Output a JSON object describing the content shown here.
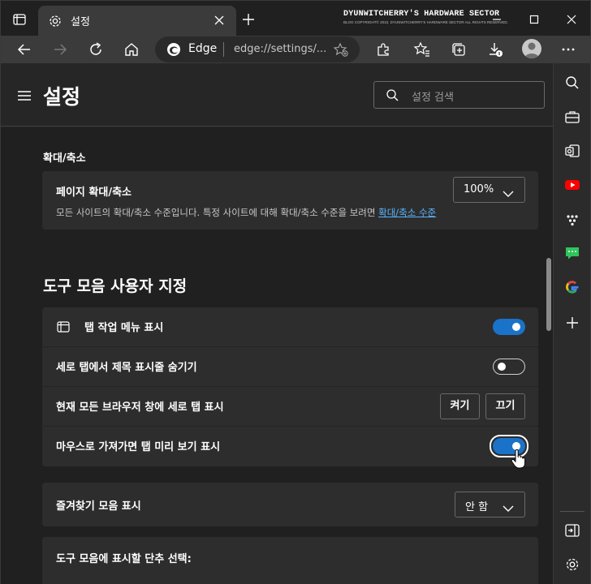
{
  "window": {
    "tab_title": "설정",
    "watermark_title": "DYUNWITCHERRY'S HARDWARE SECTOR",
    "watermark_sub": "BLOG COPYRIGHT© 2010, DYUNWITCHERRY'S HARDWARE SECTOR ALL RIGHTS RESERVED."
  },
  "toolbar": {
    "site_label": "Edge",
    "url": "edge://settings/..."
  },
  "header": {
    "title": "설정",
    "search_placeholder": "설정 검색"
  },
  "zoom": {
    "section_label": "확대/축소",
    "row_label": "페이지 확대/축소",
    "value": "100%",
    "description": "모든 사이트의 확대/축소 수준입니다. 특정 사이트에 대해 확대/축소 수준을 보려면",
    "link": "확대/축소 수준"
  },
  "toolbar_custom": {
    "heading": "도구 모음 사용자 지정",
    "rows": [
      {
        "label": "탭 작업 메뉴 표시",
        "state": "on"
      },
      {
        "label": "세로 탭에서 제목 표시줄 숨기기",
        "state": "off"
      },
      {
        "label": "현재 모든 브라우저 창에 세로 탭 표시",
        "btn_on": "켜기",
        "btn_off": "끄기"
      },
      {
        "label": "마우스로 가져가면 탭 미리 보기 표시",
        "state": "on"
      }
    ],
    "favorites_label": "즐겨찾기 모음 표시",
    "favorites_value": "안 함",
    "buttons_label": "도구 모음에 표시할 단추 선택:"
  },
  "colors": {
    "accent": "#1a73c8",
    "link": "#5ab4ff",
    "background": "#202020",
    "card": "#2d2d2d"
  },
  "icons": [
    "tab-actions-icon",
    "gear-icon",
    "close-icon",
    "plus-icon",
    "minimize-icon",
    "maximize-icon",
    "back-icon",
    "forward-icon",
    "refresh-icon",
    "home-icon",
    "edge-icon",
    "add-favorite-icon",
    "extensions-icon",
    "favorites-icon",
    "collections-icon",
    "downloads-icon",
    "profile-icon",
    "more-icon",
    "hamburger-icon",
    "search-icon",
    "chevron-down-icon",
    "tab-icon",
    "hand-cursor-icon",
    "shopping-icon",
    "outlook-icon",
    "youtube-icon",
    "apps-icon",
    "chat-icon",
    "google-icon",
    "hide-sidebar-icon"
  ]
}
